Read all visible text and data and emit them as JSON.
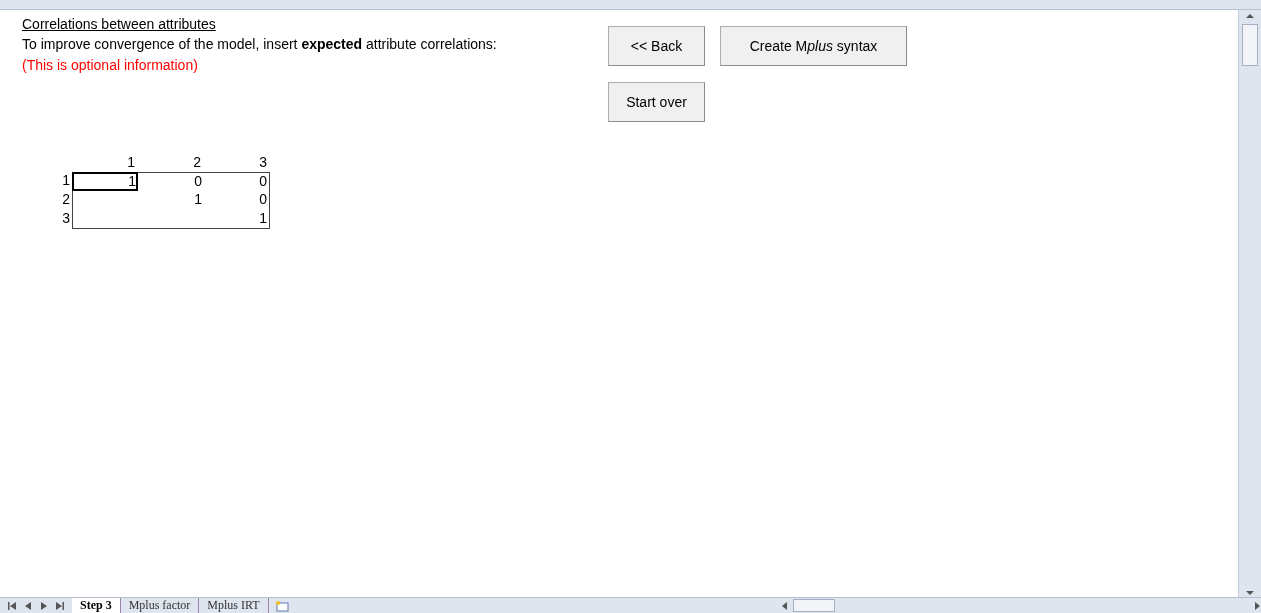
{
  "heading": "Correlations between attributes",
  "instruction": "To improve convergence of the model, insert **expected** attribute correlations:",
  "note": "(This is optional information)",
  "buttons": [
    {
      "label": "<< Back"
    },
    {
      "parts": [
        {
          "text": "Create M",
          "italic": false
        },
        {
          "text": "plus",
          "italic": true
        },
        {
          "text": " syntax",
          "italic": false
        }
      ]
    },
    {
      "label": "Start over"
    }
  ],
  "matrix": {
    "columns": [
      "1",
      "2",
      "3"
    ],
    "rows": [
      {
        "label": "1",
        "cells": [
          {
            "value": "1",
            "selected": true
          },
          {
            "value": "0",
            "selected": false
          },
          {
            "value": "0",
            "selected": false
          }
        ]
      },
      {
        "label": "2",
        "cells": [
          {
            "selected": false
          },
          {
            "value": "1",
            "selected": false
          },
          {
            "value": "0",
            "selected": false
          }
        ]
      },
      {
        "label": "3",
        "cells": [
          {
            "selected": false
          },
          {
            "selected": false
          },
          {
            "value": "1",
            "selected": false
          }
        ]
      }
    ]
  },
  "sheet_tabs": [
    {
      "label": "Step 3",
      "selected": true
    },
    {
      "label": "Mplus factor",
      "selected": false
    },
    {
      "label": "Mplus IRT",
      "selected": false
    }
  ]
}
